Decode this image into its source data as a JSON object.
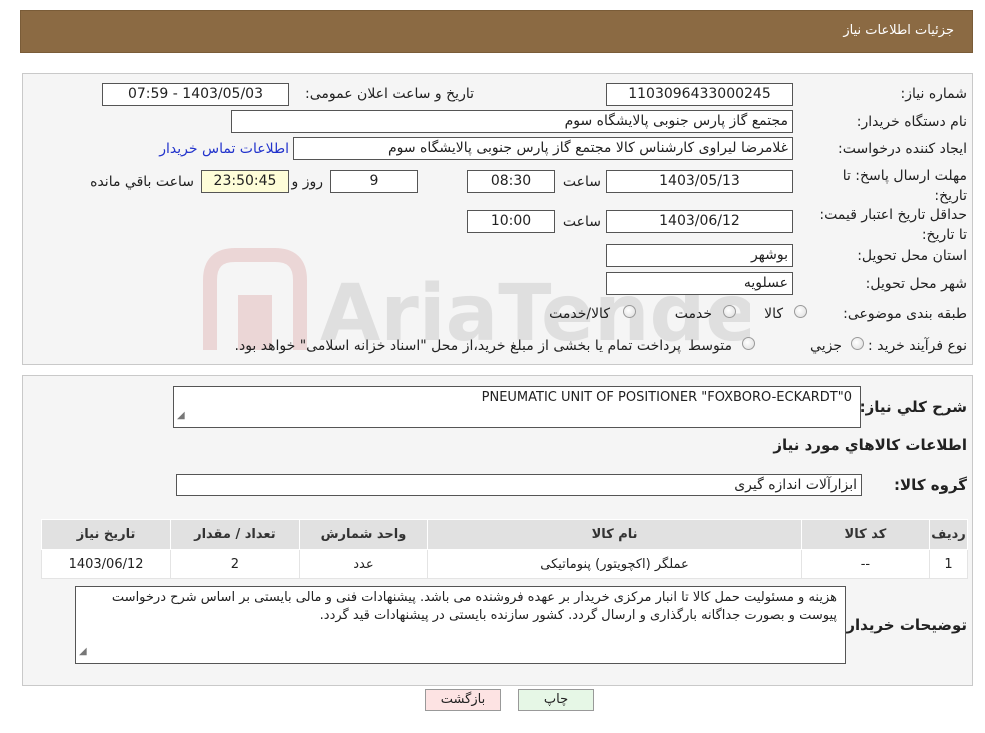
{
  "header": {
    "title": "جزئیات اطلاعات نیاز"
  },
  "form": {
    "need_number_label": "شماره نیاز:",
    "need_number": "1103096433000245",
    "announce_label": "تاریخ و ساعت اعلان عمومی:",
    "announce_value": "1403/05/03 - 07:59",
    "buyer_org_label": "نام دستگاه خریدار:",
    "buyer_org": "مجتمع گاز پارس جنوبی  پالایشگاه سوم",
    "requester_label": "ایجاد کننده درخواست:",
    "requester": "غلامرضا لیراوی کارشناس کالا مجتمع گاز پارس جنوبی  پالایشگاه سوم",
    "contact_link": "اطلاعات تماس خریدار",
    "reply_deadline_label": "مهلت ارسال پاسخ: تا تاریخ:",
    "reply_date": "1403/05/13",
    "time_label": "ساعت",
    "reply_time": "08:30",
    "days_value": "9",
    "days_label": "روز و",
    "remaining_time": "23:50:45",
    "remaining_label": "ساعت باقي مانده",
    "price_validity_label": "حداقل تاریخ اعتبار قیمت: تا تاریخ:",
    "price_date": "1403/06/12",
    "price_time": "10:00",
    "province_label": "استان محل تحویل:",
    "province": "بوشهر",
    "city_label": "شهر محل تحویل:",
    "city": "عسلویه",
    "category_label": "طبقه بندی موضوعی:",
    "category_options": [
      "کالا",
      "خدمت",
      "کالا/خدمت"
    ],
    "process_label": "نوع فرآیند خرید :",
    "process_options": [
      "جزیي",
      "متوسط"
    ],
    "process_note": "پرداخت تمام یا بخشی از مبلغ خرید،از محل \"اسناد خزانه اسلامی\" خواهد بود."
  },
  "summary": {
    "label": "شرح کلي نیاز:",
    "value": "PNEUMATIC UNIT OF POSITIONER \"FOXBORO-ECKARDT\"0"
  },
  "goods": {
    "section_title": "اطلاعات کالاهاي مورد نیاز",
    "group_label": "گروه کالا:",
    "group_value": "ابزارآلات اندازه گیری",
    "columns": [
      "ردیف",
      "کد کالا",
      "نام کالا",
      "واحد شمارش",
      "تعداد / مقدار",
      "تاریخ نیاز"
    ],
    "rows": [
      [
        "1",
        "--",
        "عملگر (اکچویتور) پنوماتیکی",
        "عدد",
        "2",
        "1403/06/12"
      ]
    ]
  },
  "buyer_notes": {
    "label": "توضیحات خریدار:",
    "text": "هزینه و مسئولیت حمل کالا تا انبار مرکزی خریدار بر عهده فروشنده می باشد. پیشنهادات فنی و مالی بایستی بر اساس شرح درخواست پیوست و بصورت جداگانه بارگذاری و ارسال گردد. کشور سازنده بایستی در پیشنهادات قید گردد."
  },
  "buttons": {
    "print": "چاپ",
    "back": "بازگشت"
  },
  "watermark_text": "AriaTender.neT",
  "colors": {
    "header": "#8b6a43",
    "link": "#2233cc",
    "back_button": "#fde3e3",
    "print_button": "#e6f7e6"
  }
}
